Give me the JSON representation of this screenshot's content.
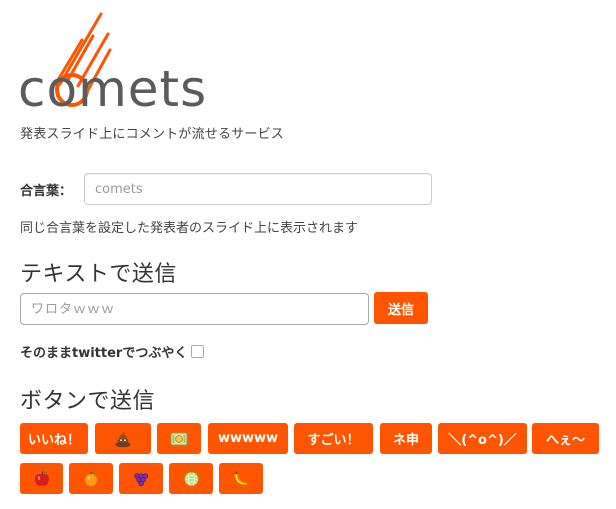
{
  "brand": {
    "name": "comets",
    "tagline": "発表スライド上にコメントが流せるサービス",
    "accent_color": "#ff5500",
    "logo_text_color": "#5b5b5b"
  },
  "passphrase": {
    "label": "合言葉：",
    "placeholder": "comets",
    "help": "同じ合言葉を設定した発表者のスライド上に表示されます"
  },
  "text_send": {
    "heading": "テキストで送信",
    "placeholder": "ワロタｗｗｗ",
    "send_label": "送信",
    "tweet_label": "そのままtwitterでつぶやく",
    "tweet_checked": false
  },
  "button_send": {
    "heading": "ボタンで送信",
    "row1": [
      {
        "label": "いいね！"
      },
      {
        "icon": "poop-icon"
      },
      {
        "icon": "money-icon"
      },
      {
        "label": "wwwww"
      },
      {
        "label": "すごい！"
      },
      {
        "label": "ネ申"
      },
      {
        "label": "＼(^o^)／"
      },
      {
        "label": "へぇ〜"
      }
    ],
    "row2": [
      {
        "icon": "apple-icon"
      },
      {
        "icon": "orange-icon"
      },
      {
        "icon": "grapes-icon"
      },
      {
        "icon": "melon-icon"
      },
      {
        "icon": "banana-icon"
      }
    ]
  }
}
